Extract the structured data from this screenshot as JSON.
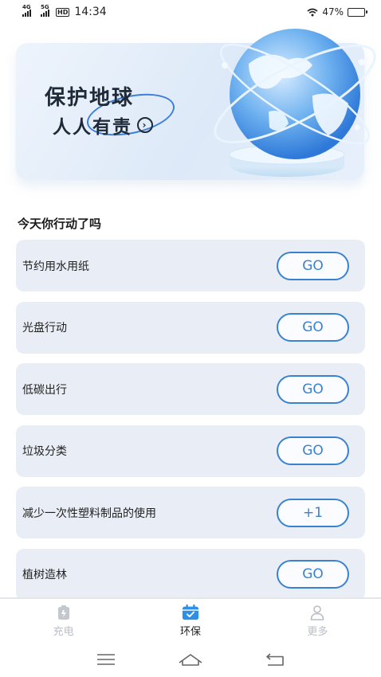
{
  "status_bar": {
    "net1": "4G",
    "net2": "5G",
    "hd": "HD",
    "time": "14:34",
    "battery_text": "47%",
    "battery_level": 0.47
  },
  "banner": {
    "title": "保护地球",
    "subtitle": "人人有责",
    "arrow_icon": "chevron-right-circle-icon"
  },
  "section": {
    "title": "今天你行动了吗"
  },
  "tasks": [
    {
      "label": "节约用水用纸",
      "button": "GO"
    },
    {
      "label": "光盘行动",
      "button": "GO"
    },
    {
      "label": "低碳出行",
      "button": "GO"
    },
    {
      "label": "垃圾分类",
      "button": "GO"
    },
    {
      "label": "减少一次性塑料制品的使用",
      "button": "+1"
    },
    {
      "label": "植树造林",
      "button": "GO"
    }
  ],
  "bottom_nav": {
    "items": [
      {
        "label": "充电",
        "icon": "battery-charge-icon",
        "active": false
      },
      {
        "label": "环保",
        "icon": "calendar-check-icon",
        "active": true
      },
      {
        "label": "更多",
        "icon": "user-icon",
        "active": false
      }
    ]
  },
  "colors": {
    "accent": "#3a82d0",
    "card_bg": "#e9eef6",
    "active_icon": "#2f8fe6",
    "inactive": "#b9bec6"
  }
}
